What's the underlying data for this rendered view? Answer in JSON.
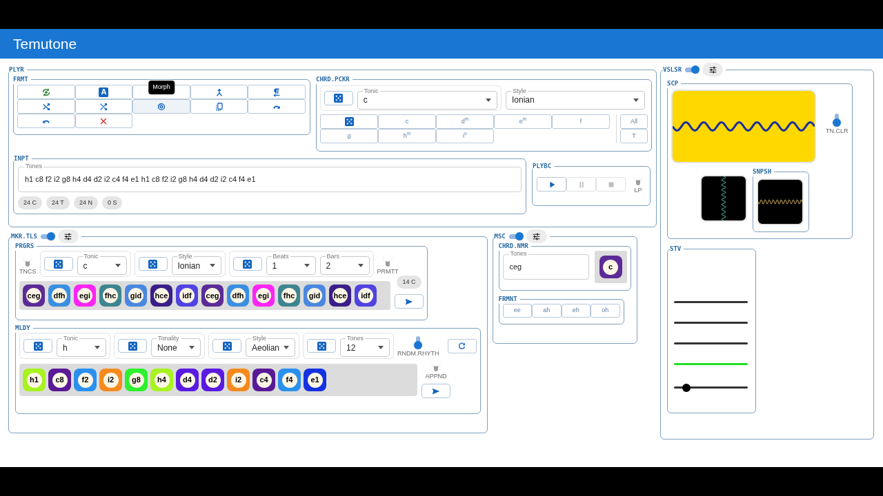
{
  "app_title": "Temutone",
  "player": {
    "legend": "PLYR",
    "format": {
      "legend": "FRMT",
      "tooltip": "Morph",
      "buttons": [
        {
          "kind": "cycle",
          "hovered": false
        },
        {
          "kind": "letter",
          "label": "A",
          "hovered": false
        },
        {
          "kind": "blank",
          "hovered": false
        },
        {
          "kind": "merge",
          "hovered": false
        },
        {
          "kind": "paragraph",
          "hovered": false
        },
        {
          "kind": "shuffle",
          "hovered": false
        },
        {
          "kind": "cross",
          "hovered": false
        },
        {
          "kind": "morph",
          "hovered": true
        },
        {
          "kind": "copy",
          "hovered": false
        },
        {
          "kind": "redo",
          "hovered": false
        },
        {
          "kind": "undo",
          "hovered": false
        },
        {
          "kind": "delete",
          "hovered": false
        }
      ]
    },
    "chord_picker": {
      "legend": "CHRD.PCKR",
      "tonic": {
        "label": "Tonic",
        "value": "c"
      },
      "style": {
        "label": "Style",
        "value": "Ionian"
      },
      "chords": [
        {
          "kind": "random"
        },
        {
          "kind": "chord",
          "label": "c"
        },
        {
          "kind": "chord",
          "label": "d$^{m}$"
        },
        {
          "kind": "chord",
          "label": "e$^{m}$"
        },
        {
          "kind": "chord",
          "label": "f"
        },
        {
          "kind": "chord",
          "label": "g"
        },
        {
          "kind": "chord",
          "label": "h$^{m}$"
        },
        {
          "kind": "chord",
          "label": "i$^{o}$"
        }
      ],
      "side_buttons": [
        "All",
        "T"
      ]
    },
    "input": {
      "legend": "INPT",
      "field_label": "Tones",
      "value": "h1 c8 f2 i2 g8 h4 d4 d2 i2 c4 f4 e1 h1 c8 f2 i2 g8 h4 d4 d2 i2 c4 f4 e1",
      "chips": [
        "24 C",
        "24 T",
        "24 N",
        "0 S"
      ]
    },
    "playback": {
      "legend": "PLYBC",
      "buttons": [
        {
          "kind": "play",
          "disabled": false
        },
        {
          "kind": "pause",
          "disabled": true
        },
        {
          "kind": "stop",
          "disabled": true
        }
      ],
      "loop": {
        "label": "LP",
        "on": false
      }
    }
  },
  "maker_tools": {
    "legend": "MKR.TLS",
    "on": true,
    "progression": {
      "legend": "PRGRS",
      "controls": [
        {
          "kind": "toggle",
          "label": "TNCS",
          "on": false
        },
        {
          "kind": "group",
          "random": true,
          "selects": [
            {
              "label": "Tonic",
              "value": "c"
            }
          ]
        },
        {
          "kind": "group",
          "random": true,
          "selects": [
            {
              "label": "Style",
              "value": "Ionian"
            }
          ]
        },
        {
          "kind": "group",
          "random": true,
          "selects": [
            {
              "label": "Beats",
              "value": "1"
            },
            {
              "label": "Bars",
              "value": "2"
            }
          ]
        },
        {
          "kind": "toggle",
          "label": "PRMTT",
          "on": false
        }
      ],
      "tiles": [
        {
          "label": "ceg",
          "color": "#5c2b97"
        },
        {
          "label": "dfh",
          "color": "#3b8fe0"
        },
        {
          "label": "egi",
          "color": "#fb24f5"
        },
        {
          "label": "fhc",
          "color": "#3d8590"
        },
        {
          "label": "gid",
          "color": "#4a88e0"
        },
        {
          "label": "hce",
          "color": "#3a1f88"
        },
        {
          "label": "idf",
          "color": "#5143e0"
        },
        {
          "label": "ceg",
          "color": "#5c2b97"
        },
        {
          "label": "dfh",
          "color": "#3b8fe0"
        },
        {
          "label": "egi",
          "color": "#fb24f5"
        },
        {
          "label": "fhc",
          "color": "#3d8590"
        },
        {
          "label": "gid",
          "color": "#4a88e0"
        },
        {
          "label": "hce",
          "color": "#3a1f88"
        },
        {
          "label": "idf",
          "color": "#5143e0"
        }
      ],
      "count": "14 C"
    },
    "melody": {
      "legend": "MLDY",
      "controls": [
        {
          "kind": "group",
          "random": true,
          "selects": [
            {
              "label": "Tonic",
              "value": "h"
            }
          ]
        },
        {
          "kind": "group",
          "random": true,
          "selects": [
            {
              "label": "Tonality",
              "value": "None"
            }
          ]
        },
        {
          "kind": "group",
          "random": true,
          "selects": [
            {
              "label": "Style",
              "value": "Aeolian"
            }
          ]
        },
        {
          "kind": "group",
          "random": true,
          "selects": [
            {
              "label": "Tones",
              "value": "12"
            }
          ]
        },
        {
          "kind": "toggle",
          "label": "RNDM.RHYTH",
          "on": true
        }
      ],
      "tiles": [
        {
          "label": "h1",
          "color": "#a8f21f"
        },
        {
          "label": "c8",
          "color": "#5a1a96"
        },
        {
          "label": "f2",
          "color": "#2a90f0"
        },
        {
          "label": "i2",
          "color": "#f78a1e"
        },
        {
          "label": "g8",
          "color": "#2ef02e"
        },
        {
          "label": "h4",
          "color": "#a8f21f"
        },
        {
          "label": "d4",
          "color": "#5a1ae0"
        },
        {
          "label": "d2",
          "color": "#5a1ae0"
        },
        {
          "label": "i2",
          "color": "#f78a1e"
        },
        {
          "label": "c4",
          "color": "#5a1a96"
        },
        {
          "label": "f4",
          "color": "#2a90f0"
        },
        {
          "label": "e1",
          "color": "#1432e0"
        }
      ],
      "append": {
        "label": "APPND",
        "on": false
      }
    }
  },
  "music": {
    "legend": "MSC",
    "on": true,
    "chord_namer": {
      "legend": "CHRD.NMR",
      "field_label": "Tones",
      "value": "ceg",
      "tile": {
        "label": "c",
        "color": "#5c2b97"
      }
    },
    "formant": {
      "legend": "FRMNT",
      "buttons": [
        "ee",
        "ah",
        "eh",
        "oh"
      ]
    }
  },
  "visualiser": {
    "legend": "VSLSR",
    "on": true,
    "scope": {
      "legend": "SCP",
      "tone_color": {
        "label": "TN.CLR",
        "on": true
      },
      "snapshot_legend": "SNPSH"
    },
    "stv": {
      "legend": "STV",
      "lines": [
        {
          "active": false
        },
        {
          "active": false
        },
        {
          "active": false
        },
        {
          "active": true
        }
      ],
      "slider": {
        "level": 0.17
      }
    }
  }
}
